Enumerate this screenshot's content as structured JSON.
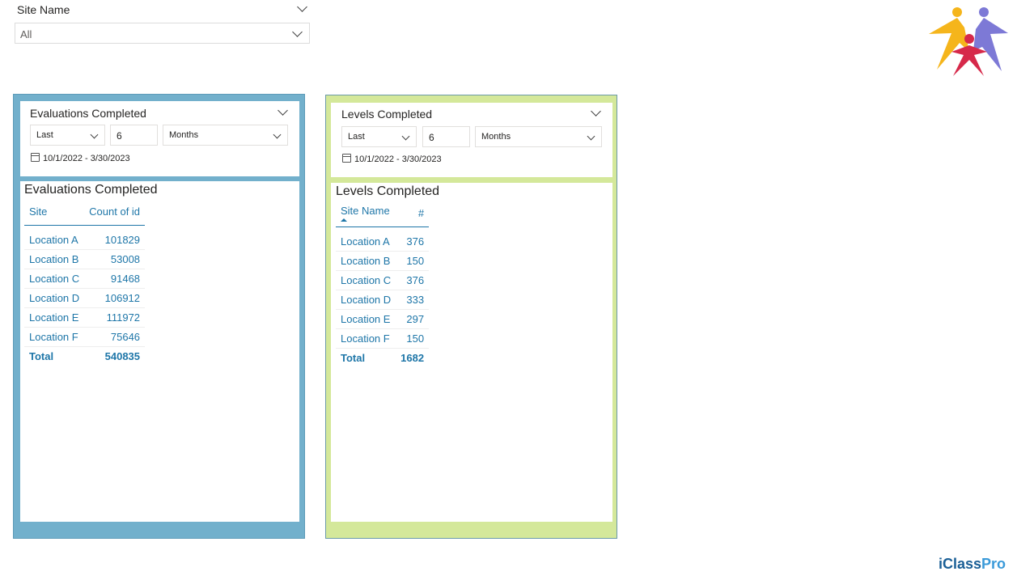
{
  "site_slicer": {
    "title": "Site Name",
    "value": "All"
  },
  "evaluations": {
    "filter": {
      "title": "Evaluations Completed",
      "period": "Last",
      "count": "6",
      "unit": "Months",
      "date_range": "10/1/2022 - 3/30/2023"
    },
    "table": {
      "title": "Evaluations Completed",
      "col_site": "Site",
      "col_value": "Count of id",
      "rows": [
        {
          "site": "Location A",
          "value": "101829"
        },
        {
          "site": "Location B",
          "value": "53008"
        },
        {
          "site": "Location C",
          "value": "91468"
        },
        {
          "site": "Location D",
          "value": "106912"
        },
        {
          "site": "Location E",
          "value": "111972"
        },
        {
          "site": "Location F",
          "value": "75646"
        }
      ],
      "total_label": "Total",
      "total_value": "540835"
    },
    "color": "#72b0cc"
  },
  "levels": {
    "filter": {
      "title": "Levels Completed",
      "period": "Last",
      "count": "6",
      "unit": "Months",
      "date_range": "10/1/2022 - 3/30/2023"
    },
    "table": {
      "title": "Levels Completed",
      "col_site": "Site Name",
      "col_value": "#",
      "rows": [
        {
          "site": "Location A",
          "value": "376"
        },
        {
          "site": "Location B",
          "value": "150"
        },
        {
          "site": "Location C",
          "value": "376"
        },
        {
          "site": "Location D",
          "value": "333"
        },
        {
          "site": "Location E",
          "value": "297"
        },
        {
          "site": "Location F",
          "value": "150"
        }
      ],
      "total_label": "Total",
      "total_value": "1682"
    },
    "color": "#d4e89a"
  },
  "brand": {
    "name_a": "iClass",
    "name_b": "Pro",
    "color_a": "#1a5f96",
    "color_b": "#3a9ad9"
  },
  "logo_icon": "people-stars-logo"
}
